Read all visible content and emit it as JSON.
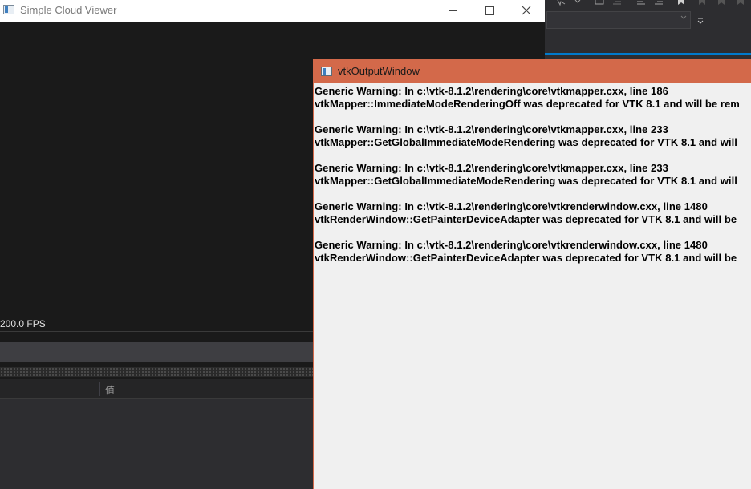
{
  "viewer": {
    "title": "Simple Cloud Viewer",
    "fps": "200.0 FPS",
    "value_column_label": "值"
  },
  "vtk_window": {
    "title": "vtkOutputWindow",
    "messages": [
      {
        "line1": "Generic Warning: In c:\\vtk-8.1.2\\rendering\\core\\vtkmapper.cxx, line 186",
        "line2": "vtkMapper::ImmediateModeRenderingOff was deprecated for VTK 8.1 and will be rem"
      },
      {
        "line1": "Generic Warning: In c:\\vtk-8.1.2\\rendering\\core\\vtkmapper.cxx, line 233",
        "line2": "vtkMapper::GetGlobalImmediateModeRendering was deprecated for VTK 8.1 and will"
      },
      {
        "line1": "Generic Warning: In c:\\vtk-8.1.2\\rendering\\core\\vtkmapper.cxx, line 233",
        "line2": "vtkMapper::GetGlobalImmediateModeRendering was deprecated for VTK 8.1 and will"
      },
      {
        "line1": "Generic Warning: In c:\\vtk-8.1.2\\rendering\\core\\vtkrenderwindow.cxx, line 1480",
        "line2": "vtkRenderWindow::GetPainterDeviceAdapter was deprecated for VTK 8.1 and will be"
      },
      {
        "line1": "Generic Warning: In c:\\vtk-8.1.2\\rendering\\core\\vtkrenderwindow.cxx, line 1480",
        "line2": "vtkRenderWindow::GetPainterDeviceAdapter was deprecated for VTK 8.1 and will be"
      }
    ]
  },
  "colors": {
    "vtk_titlebar": "#d3694a",
    "vs_accent": "#007acc",
    "viewer_background": "#1a1a1a"
  }
}
